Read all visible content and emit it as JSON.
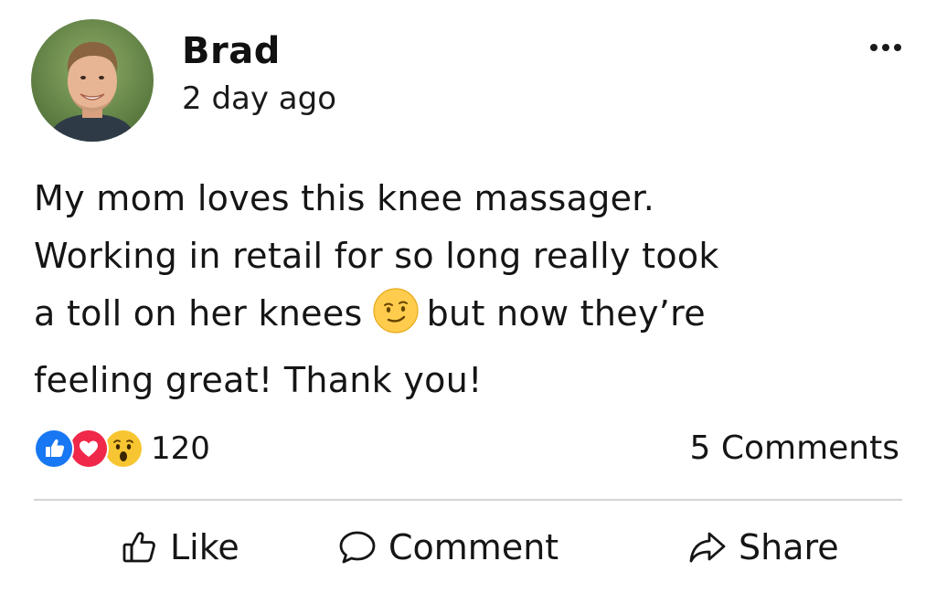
{
  "post": {
    "author": "Brad",
    "timestamp": "2 day ago",
    "text_lines": [
      "My mom loves this knee massager.",
      "Working in retail for so long really took",
      "a toll on her knees",
      "but now they’re",
      "feeling great! Thank you!"
    ],
    "inline_emoji": "smirk-face-emoji"
  },
  "reactions": {
    "icons": [
      "like-reaction-icon",
      "love-reaction-icon",
      "wow-reaction-icon"
    ],
    "count": "120"
  },
  "comments_label": "5 Comments",
  "actions": {
    "like": "Like",
    "comment": "Comment",
    "share": "Share"
  },
  "colors": {
    "like_blue": "#1877f2",
    "love_red": "#f02849",
    "wow_yellow": "#f7c531",
    "divider": "#d4d4d4"
  }
}
